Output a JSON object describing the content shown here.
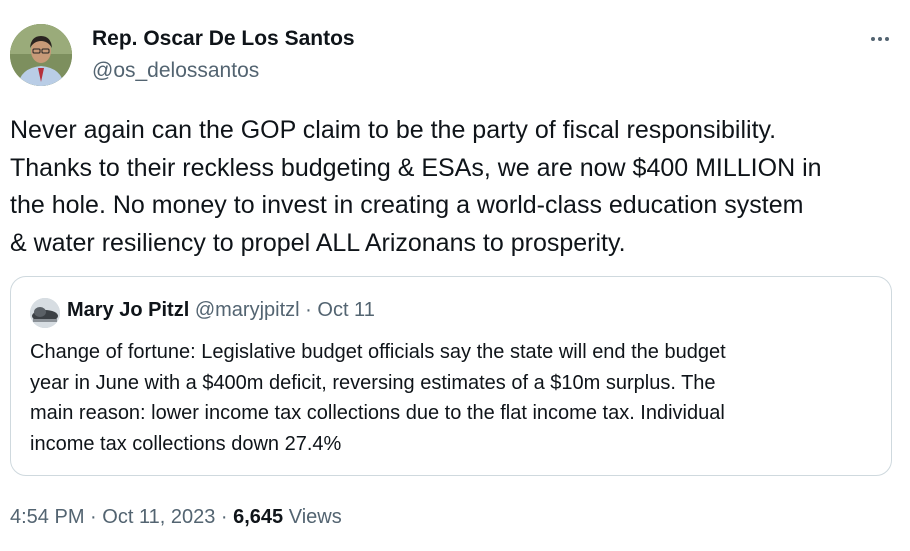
{
  "author": {
    "name": "Rep. Oscar De Los Santos",
    "handle": "@os_delossantos"
  },
  "more_icon": "more-horizontal-icon",
  "tweet": {
    "lines": [
      "Never again can the GOP claim to be the party of fiscal responsibility.",
      "Thanks to their reckless budgeting & ESAs, we are now $400 MILLION in",
      "the hole. No money to invest in creating a world-class education system",
      "& water resiliency to propel ALL Arizonans to prosperity."
    ]
  },
  "quote": {
    "name": "Mary Jo Pitzl",
    "handle": "@maryjpitzl",
    "separator": "·",
    "date": "Oct 11",
    "lines": [
      "Change of fortune: Legislative budget officials say the state will end the budget",
      "year in June with a $400m deficit, reversing estimates of a $10m surplus.  The",
      "main reason: lower income tax collections due to the flat income tax. Individual",
      "income tax collections down 27.4%"
    ]
  },
  "footer": {
    "time": "4:54 PM",
    "separator": "·",
    "date": "Oct 11, 2023",
    "views_count": "6,645",
    "views_label": "Views"
  },
  "colors": {
    "text_primary": "#0f1419",
    "text_secondary": "#536471",
    "border": "#cfd9de",
    "background": "#ffffff"
  }
}
